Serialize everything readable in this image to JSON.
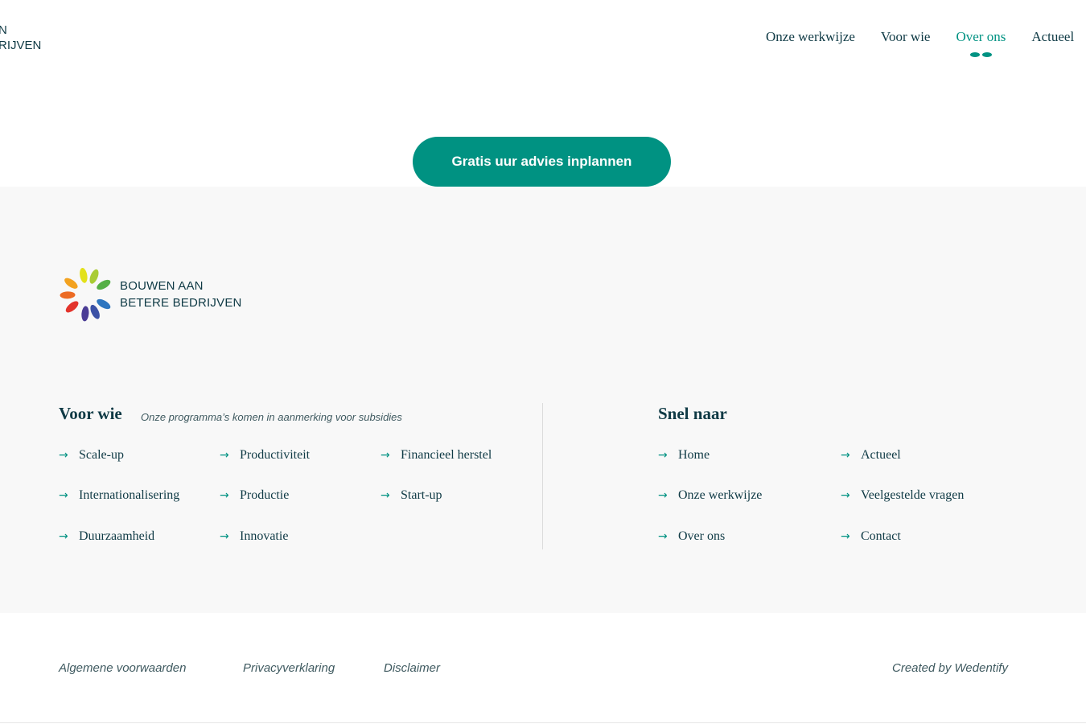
{
  "header": {
    "logo_line1": "N",
    "logo_line2": "RIJVEN",
    "nav": [
      {
        "label": "Onze werkwijze"
      },
      {
        "label": "Voor wie"
      },
      {
        "label": "Over ons"
      },
      {
        "label": "Actueel"
      }
    ],
    "active_nav": "Over ons"
  },
  "cta": {
    "label": "Gratis uur advies inplannen"
  },
  "footer": {
    "logo_line1": "BOUWEN AAN",
    "logo_line2": "BETERE BEDRIJVEN",
    "voor_wie": {
      "title": "Voor wie",
      "subtitle": "Onze programma’s komen in aanmerking voor subsidies",
      "links": [
        "Scale-up",
        "Productiviteit",
        "Financieel herstel",
        "Internationalisering",
        "Productie",
        "Start-up",
        "Duurzaamheid",
        "Innovatie"
      ]
    },
    "snel_naar": {
      "title": "Snel naar",
      "links": [
        "Home",
        "Actueel",
        "Onze werkwijze",
        "Veelgestelde vragen",
        "Over ons",
        "Contact"
      ]
    },
    "arrow_icon": "arrow-right-icon"
  },
  "bottom": {
    "links": [
      "Algemene voorwaarden",
      "Privacyverklaring",
      "Disclaimer"
    ],
    "credit": "Created by Wedentify"
  },
  "colors": {
    "accent": "#009282",
    "text": "#0f3a45",
    "footer_bg": "#f8f8f8"
  }
}
